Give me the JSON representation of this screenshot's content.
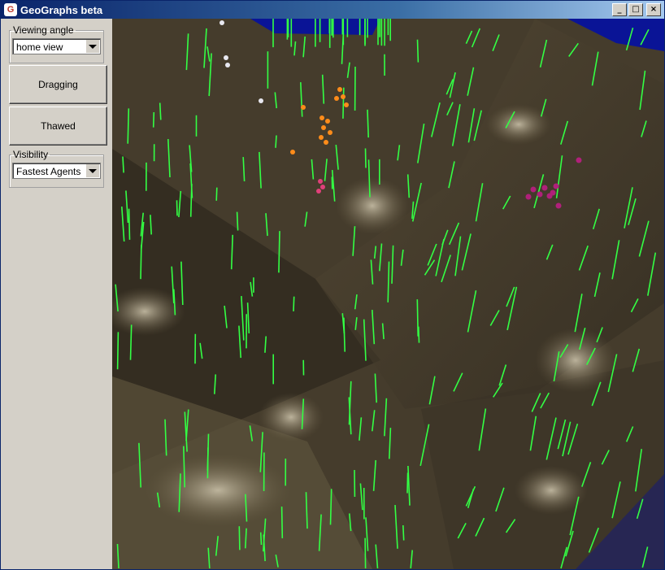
{
  "window": {
    "title": "GeoGraphs beta",
    "controls": {
      "minimize": "_",
      "maximize": "□",
      "close": "×"
    }
  },
  "panel": {
    "viewing_angle": {
      "label": "Viewing angle",
      "selected": "home view"
    },
    "dragging_button": "Dragging",
    "thawed_button": "Thawed",
    "visibility": {
      "label": "Visibility",
      "selected": "Fastest Agents"
    }
  },
  "scene": {
    "description_colors": {
      "terrain_dark": "#3a3226",
      "terrain_light": "#8a7a5a",
      "water": "#0a1496",
      "agent_trails": "#33ff44",
      "agents_white": "#e8e8f0",
      "agents_orange": "#ff8c1a",
      "agents_pink": "#e0407a",
      "agents_magenta": "#b0207a"
    }
  }
}
